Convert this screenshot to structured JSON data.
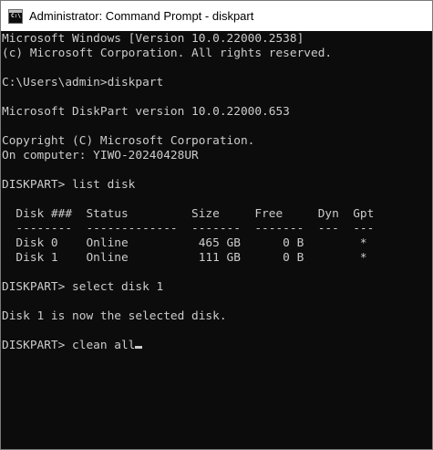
{
  "window": {
    "title": "Administrator: Command Prompt - diskpart",
    "icon": "cmd-icon",
    "icon_glyph": "C:\\"
  },
  "colors": {
    "console_bg": "#0c0c0c",
    "console_text": "#cccccc",
    "titlebar_bg": "#ffffff"
  },
  "console": {
    "lines": [
      "Microsoft Windows [Version 10.0.22000.2538]",
      "(c) Microsoft Corporation. All rights reserved.",
      "",
      "C:\\Users\\admin>diskpart",
      "",
      "Microsoft DiskPart version 10.0.22000.653",
      "",
      "Copyright (C) Microsoft Corporation.",
      "On computer: YIWO-20240428UR",
      "",
      "DISKPART> list disk",
      "",
      "  Disk ###  Status         Size     Free     Dyn  Gpt",
      "  --------  -------------  -------  -------  ---  ---",
      "  Disk 0    Online          465 GB      0 B        *",
      "  Disk 1    Online          111 GB      0 B        *",
      "",
      "DISKPART> select disk 1",
      "",
      "Disk 1 is now the selected disk.",
      "",
      "DISKPART> clean all"
    ]
  }
}
